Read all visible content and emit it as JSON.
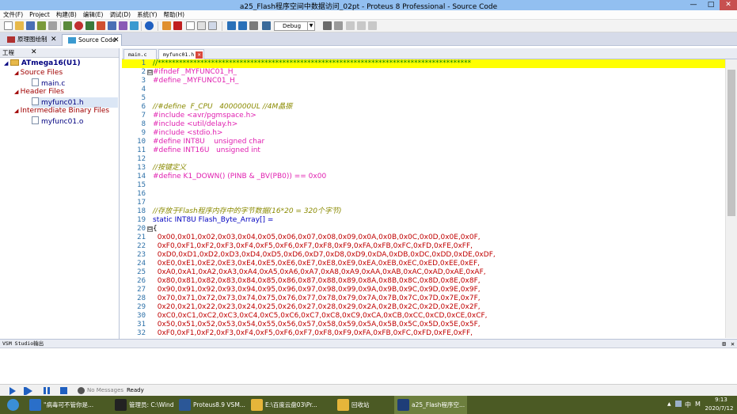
{
  "window": {
    "title": "a25_Flash程序空间中数据访问_02pt - Proteus 8 Professional - Source Code",
    "min": "—",
    "max": "□",
    "close": "✕"
  },
  "menu": [
    "文件(F)",
    "Project",
    "构建(B)",
    "编辑(E)",
    "调试(D)",
    "系统(Y)",
    "帮助(H)"
  ],
  "toolbar": {
    "config": "Debug"
  },
  "tabs": [
    {
      "label": "原理图绘制",
      "close": "✕"
    },
    {
      "label": "Source Code",
      "close": "✕"
    }
  ],
  "project": {
    "header": "工程",
    "close": "✕",
    "root": "ATmega16(U1)",
    "groups": [
      {
        "label": "Source Files",
        "files": [
          "main.c"
        ]
      },
      {
        "label": "Header Files",
        "files": [
          "myfunc01.h"
        ]
      },
      {
        "label": "Intermediate Binary Files",
        "files": [
          "myfunc01.o"
        ]
      }
    ]
  },
  "editor": {
    "tabs": [
      "main.c",
      "myfunc01.h"
    ],
    "lines": [
      {
        "n": "1",
        "t": "//****************************************************************************************",
        "c": "#008000",
        "hl": true
      },
      {
        "n": "2",
        "t": "#ifndef _MYFUNC01_H_",
        "c": "#e020b0",
        "fold": "⊟"
      },
      {
        "n": "3",
        "t": "#define _MYFUNC01_H_",
        "c": "#e020b0"
      },
      {
        "n": "4",
        "t": "",
        "c": "#000"
      },
      {
        "n": "5",
        "t": "",
        "c": "#000"
      },
      {
        "n": "6",
        "t": "//#define  F_CPU   4000000UL //4M晶振",
        "c": "#8a8a00",
        "i": true
      },
      {
        "n": "7",
        "t": "#include <avr/pgmspace.h>",
        "c": "#e020b0"
      },
      {
        "n": "8",
        "t": "#include <util/delay.h>",
        "c": "#e020b0"
      },
      {
        "n": "9",
        "t": "#include <stdio.h>",
        "c": "#e020b0"
      },
      {
        "n": "10",
        "t": "#define INT8U    unsigned char",
        "c": "#e020b0"
      },
      {
        "n": "11",
        "t": "#define INT16U   unsigned int",
        "c": "#e020b0"
      },
      {
        "n": "12",
        "t": "",
        "c": "#000"
      },
      {
        "n": "13",
        "t": "//按键定义",
        "c": "#8a8a00",
        "i": true
      },
      {
        "n": "14",
        "t": "#define K1_DOWN() (PINB & _BV(PB0)) == 0x00",
        "c": "#e020b0"
      },
      {
        "n": "15",
        "t": "",
        "c": "#000"
      },
      {
        "n": "16",
        "t": "",
        "c": "#000"
      },
      {
        "n": "17",
        "t": "",
        "c": "#000"
      },
      {
        "n": "18",
        "t": "//存放于Flash程序内存中的字节数据(16*20 = 320个字节)",
        "c": "#8a8a00",
        "i": true
      },
      {
        "n": "19",
        "t": "static INT8U Flash_Byte_Array[] =",
        "c": "#0000c0"
      },
      {
        "n": "20",
        "t": "{",
        "c": "#000",
        "fold": "⊟"
      },
      {
        "n": "21",
        "t": "  0x00,0x01,0x02,0x03,0x04,0x05,0x06,0x07,0x08,0x09,0x0A,0x0B,0x0C,0x0D,0x0E,0x0F,",
        "c": "#c00000"
      },
      {
        "n": "22",
        "t": "  0xF0,0xF1,0xF2,0xF3,0xF4,0xF5,0xF6,0xF7,0xF8,0xF9,0xFA,0xFB,0xFC,0xFD,0xFE,0xFF,",
        "c": "#c00000"
      },
      {
        "n": "23",
        "t": "  0xD0,0xD1,0xD2,0xD3,0xD4,0xD5,0xD6,0xD7,0xD8,0xD9,0xDA,0xDB,0xDC,0xDD,0xDE,0xDF,",
        "c": "#c00000"
      },
      {
        "n": "24",
        "t": "  0xE0,0xE1,0xE2,0xE3,0xE4,0xE5,0xE6,0xE7,0xE8,0xE9,0xEA,0xEB,0xEC,0xED,0xEE,0xEF,",
        "c": "#c00000"
      },
      {
        "n": "25",
        "t": "  0xA0,0xA1,0xA2,0xA3,0xA4,0xA5,0xA6,0xA7,0xA8,0xA9,0xAA,0xAB,0xAC,0xAD,0xAE,0xAF,",
        "c": "#c00000"
      },
      {
        "n": "26",
        "t": "  0x80,0x81,0x82,0x83,0x84,0x85,0x86,0x87,0x88,0x89,0x8A,0x8B,0x8C,0x8D,0x8E,0x8F,",
        "c": "#c00000"
      },
      {
        "n": "27",
        "t": "  0x90,0x91,0x92,0x93,0x94,0x95,0x96,0x97,0x98,0x99,0x9A,0x9B,0x9C,0x9D,0x9E,0x9F,",
        "c": "#c00000"
      },
      {
        "n": "28",
        "t": "  0x70,0x71,0x72,0x73,0x74,0x75,0x76,0x77,0x78,0x79,0x7A,0x7B,0x7C,0x7D,0x7E,0x7F,",
        "c": "#c00000"
      },
      {
        "n": "29",
        "t": "  0x20,0x21,0x22,0x23,0x24,0x25,0x26,0x27,0x28,0x29,0x2A,0x2B,0x2C,0x2D,0x2E,0x2F,",
        "c": "#c00000"
      },
      {
        "n": "30",
        "t": "  0xC0,0xC1,0xC2,0xC3,0xC4,0xC5,0xC6,0xC7,0xC8,0xC9,0xCA,0xCB,0xCC,0xCD,0xCE,0xCF,",
        "c": "#c00000"
      },
      {
        "n": "31",
        "t": "  0x50,0x51,0x52,0x53,0x54,0x55,0x56,0x57,0x58,0x59,0x5A,0x5B,0x5C,0x5D,0x5E,0x5F,",
        "c": "#c00000"
      },
      {
        "n": "32",
        "t": "  0xF0,0xF1,0xF2,0xF3,0xF4,0xF5,0xF6,0xF7,0xF8,0xF9,0xFA,0xFB,0xFC,0xFD,0xFE,0xFF,",
        "c": "#c00000"
      }
    ]
  },
  "output": {
    "header": "VSM Studio输出",
    "pin": "⊞",
    "close": "✕"
  },
  "status": {
    "messages": "No Messages",
    "state": "Ready"
  },
  "taskbar": {
    "items": [
      {
        "label": "\"病毒可不管你是...",
        "color": "#2a6fc9"
      },
      {
        "label": "管理员: C:\\Wind...",
        "color": "#222222"
      },
      {
        "label": "Proteus8.9 VSM...",
        "color": "#2b5797"
      },
      {
        "label": "E:\\百度云盘03\\Pr...",
        "color": "#e6b53a"
      },
      {
        "label": "回收站",
        "color": "#e6b53a"
      },
      {
        "label": "a25_Flash程序空...",
        "color": "#1e3d78"
      }
    ],
    "time": "9:13",
    "date": "2020/7/12",
    "ime": "中",
    "lang": "M"
  }
}
